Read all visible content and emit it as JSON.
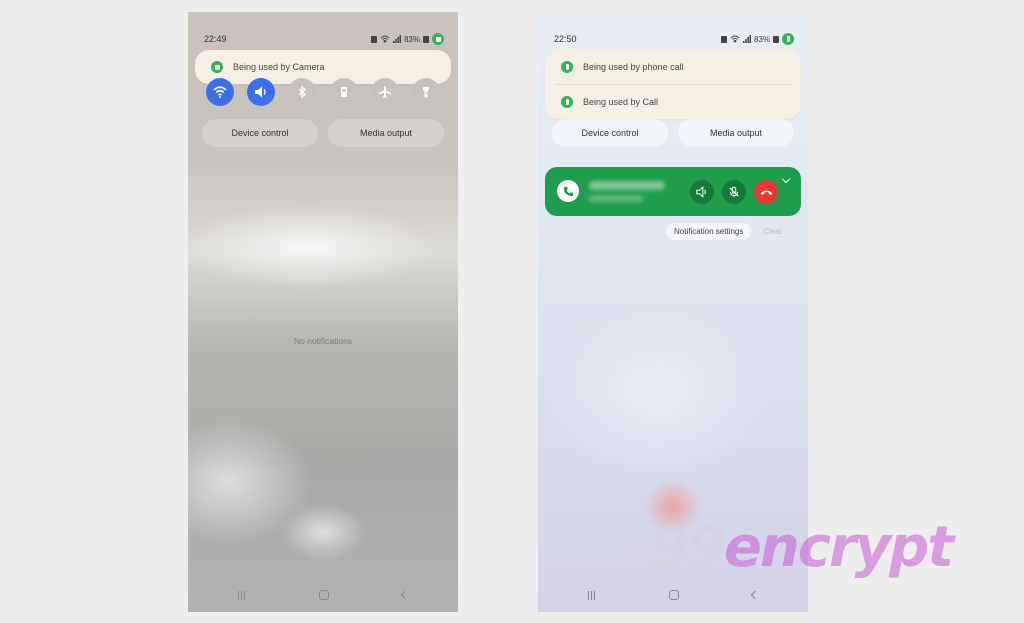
{
  "left_phone": {
    "time": "22:49",
    "battery": "83%",
    "privacy_popup": [
      {
        "label": "Being used by Camera",
        "icon": "camera-icon"
      }
    ],
    "quick_settings": [
      {
        "name": "wifi",
        "on": true,
        "icon": "wifi-icon"
      },
      {
        "name": "sound",
        "on": true,
        "icon": "speaker-icon"
      },
      {
        "name": "bluetooth",
        "on": false,
        "icon": "bluetooth-icon"
      },
      {
        "name": "rotation",
        "on": false,
        "icon": "rotation-icon"
      },
      {
        "name": "airplane",
        "on": false,
        "icon": "airplane-icon"
      },
      {
        "name": "flashlight",
        "on": false,
        "icon": "flashlight-icon"
      }
    ],
    "device_control": "Device control",
    "media_output": "Media output",
    "empty_text": "No notifications"
  },
  "right_phone": {
    "time": "22:50",
    "battery": "83%",
    "privacy_popup": [
      {
        "label": "Being used by phone call",
        "icon": "microphone-icon"
      },
      {
        "label": "Being used by Call",
        "icon": "microphone-icon"
      }
    ],
    "device_control": "Device control",
    "media_output": "Media output",
    "notification_settings": "Notification settings",
    "clear": "Clear"
  },
  "watermark": {
    "prefix": "99",
    "suffix": "encrypt"
  },
  "colors": {
    "accent_blue": "#3d6fe8",
    "call_green": "#1f9d4c",
    "end_red": "#e53935",
    "privacy_green": "#34b35a"
  }
}
